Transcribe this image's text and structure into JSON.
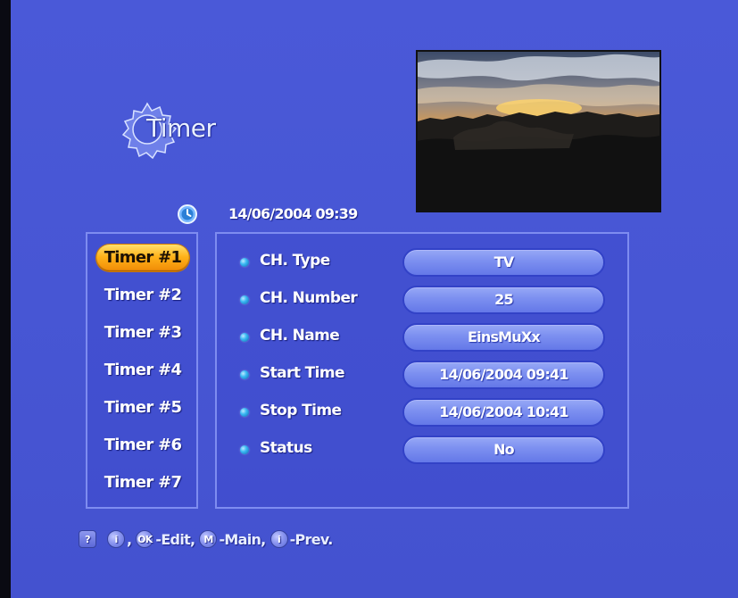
{
  "title": "Timer",
  "datetime": "14/06/2004 09:39",
  "timers": [
    "Timer #1",
    "Timer #2",
    "Timer #3",
    "Timer #4",
    "Timer #5",
    "Timer #6",
    "Timer #7"
  ],
  "selected_timer": "Timer #1",
  "fields": [
    {
      "label": "CH. Type",
      "value": "TV"
    },
    {
      "label": "CH. Number",
      "value": "25"
    },
    {
      "label": "CH. Name",
      "value": "EinsMuXx"
    },
    {
      "label": "Start Time",
      "value": "14/06/2004 09:41"
    },
    {
      "label": "Stop Time",
      "value": "14/06/2004 10:41"
    },
    {
      "label": "Status",
      "value": "No"
    }
  ],
  "help": {
    "help_glyph": "?",
    "info_glyph": "i",
    "ok_glyph": "OK",
    "main_glyph": "M",
    "prev_glyph": "i",
    "sep_comma": ",",
    "edit_text": "-Edit,",
    "main_text": "-Main,",
    "prev_text": "-Prev."
  },
  "icons": {
    "title": "gear-icon",
    "clock": "clock-icon",
    "bullet": "bullet-dot-icon"
  },
  "colors": {
    "background": "#4756d4",
    "selected": "#ffb219",
    "pill": "#7c8ff0",
    "panel_border": "#7e8cf0"
  }
}
